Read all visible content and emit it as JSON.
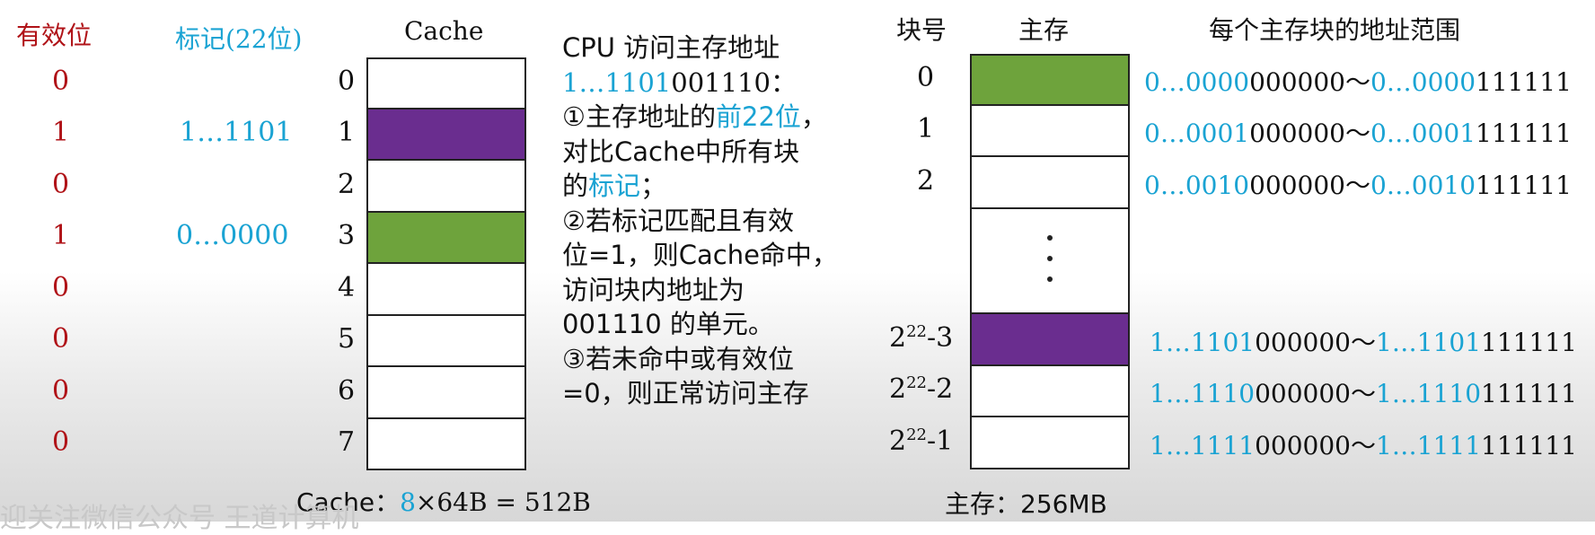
{
  "colors": {
    "green": "#6ea33c",
    "purple": "#6a2d8f",
    "white": "#ffffff",
    "red": "#b01318",
    "blue": "#1aa3d3"
  },
  "left": {
    "valid_header": "有效位",
    "tag_header": "标记(22位)",
    "cache_title": "Cache",
    "valid_bits": [
      "0",
      "1",
      "0",
      "1",
      "0",
      "0",
      "0",
      "0"
    ],
    "tags": [
      "",
      "1…1101",
      "",
      "0…0000",
      "",
      "",
      "",
      ""
    ],
    "line_numbers": [
      "0",
      "1",
      "2",
      "3",
      "4",
      "5",
      "6",
      "7"
    ],
    "cache_fill": [
      "white",
      "purple",
      "white",
      "green",
      "white",
      "white",
      "white",
      "white"
    ],
    "cache_size": {
      "prefix": "Cache：",
      "count": "8",
      "rest": "×64B = 512B"
    }
  },
  "middle": {
    "line1": "CPU 访问主存地址",
    "addr_blue": "1…1101",
    "addr_black": "001110：",
    "step1_a": "①主存地址的",
    "step1_b": "前22位",
    "step1_c": "，",
    "step1_d": "对比Cache中所有块",
    "step1_e": "的",
    "step1_f": "标记",
    "step1_g": "；",
    "step2_a": "②若标记匹配且有效",
    "step2_b": "位=1，则Cache命中，",
    "step2_c": "访问块内地址为",
    "step2_d": "001110 的单元。",
    "step3_a": "③若未命中或有效位",
    "step3_b": "=0，则正常访问主存"
  },
  "right": {
    "blockno_header": "块号",
    "mem_header": "主存",
    "range_header": "每个主存块的地址范围",
    "block_numbers": [
      "0",
      "1",
      "2"
    ],
    "high_blocks": [
      {
        "base": "2",
        "exp": "22",
        "suffix": "-3"
      },
      {
        "base": "2",
        "exp": "22",
        "suffix": "-2"
      },
      {
        "base": "2",
        "exp": "22",
        "suffix": "-1"
      }
    ],
    "mem_fill_top": [
      "green",
      "white",
      "white"
    ],
    "mem_fill_bottom": [
      "purple",
      "white",
      "white"
    ],
    "ranges": [
      {
        "p1": "0…0000",
        "s1": "000000～",
        "p2": "0…0000",
        "s2": "111111"
      },
      {
        "p1": "0…0001",
        "s1": "000000～",
        "p2": "0…0001",
        "s2": "111111"
      },
      {
        "p1": "0…0010",
        "s1": "000000～",
        "p2": "0…0010",
        "s2": "111111"
      },
      {
        "p1": "1…1101",
        "s1": "000000～",
        "p2": "1…1101",
        "s2": "111111"
      },
      {
        "p1": "1…1110",
        "s1": "000000～",
        "p2": "1…1110",
        "s2": "111111"
      },
      {
        "p1": "1…1111",
        "s1": "000000～",
        "p2": "1…1111",
        "s2": "111111"
      }
    ],
    "mem_size": "主存：256MB"
  },
  "watermark": "迎关注微信公众号 王道计算机"
}
